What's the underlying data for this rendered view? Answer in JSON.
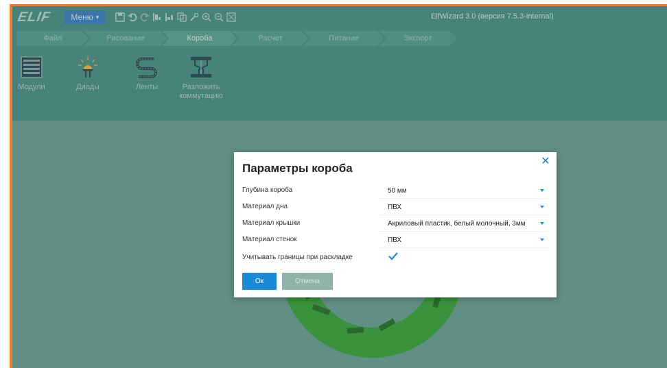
{
  "app": {
    "logo_text": "ELIF",
    "menu_label": "Меню",
    "title": "ElfWizard 3.0 (версия 7.5.3-internal)"
  },
  "toolbar_icons": [
    "save-icon",
    "undo-icon",
    "redo-icon",
    "align-left-icon",
    "align-right-icon",
    "copy-icon",
    "settings-icon",
    "zoom-in-icon",
    "zoom-out-icon",
    "fit-screen-icon"
  ],
  "nav": {
    "tabs": [
      {
        "label": "Файл"
      },
      {
        "label": "Рисование"
      },
      {
        "label": "Короба"
      },
      {
        "label": "Расчет"
      },
      {
        "label": "Питание"
      },
      {
        "label": "Экспорт"
      }
    ],
    "active_index": 2
  },
  "ribbon": {
    "items": [
      {
        "label": "Модули"
      },
      {
        "label": "Диоды"
      },
      {
        "label": "Ленты"
      },
      {
        "label": "Разложить коммутацию"
      }
    ]
  },
  "dialog": {
    "title": "Параметры короба",
    "fields": [
      {
        "label": "Глубина короба",
        "value": "50 мм"
      },
      {
        "label": "Материал дна",
        "value": "ПВХ"
      },
      {
        "label": "Материал крышки",
        "value": "Акриловый пластик, белый молочный, 3мм"
      },
      {
        "label": "Материал стенок",
        "value": "ПВХ"
      }
    ],
    "checkbox": {
      "label": "Учитывать границы при раскладке",
      "checked": true
    },
    "ok_label": "Ок",
    "cancel_label": "Отмена"
  },
  "colors": {
    "frame_orange": "#f07c2a",
    "header_teal": "#4f8f83",
    "canvas_teal": "#6f9e93",
    "accent_blue": "#1a8bd9",
    "ring_green": "#3fa33a"
  }
}
